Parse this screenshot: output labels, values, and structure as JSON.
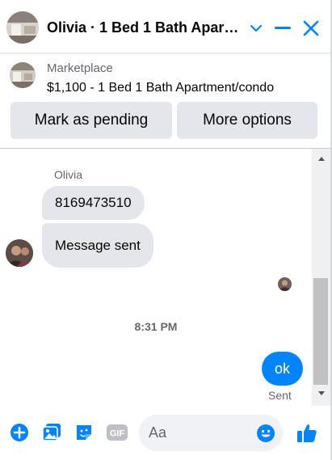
{
  "header": {
    "title": "Olivia · 1 Bed 1 Bath Apartment/condo",
    "icons": [
      "chevron-down-icon",
      "minimize-icon",
      "close-icon"
    ]
  },
  "marketplace": {
    "label": "Marketplace",
    "listing": "$1,100 - 1 Bed 1 Bath Apartment/condo",
    "buttons": {
      "pending": "Mark as pending",
      "more": "More options"
    }
  },
  "messages": {
    "sender": "Olivia",
    "incoming": [
      "8169473510",
      "Message sent"
    ],
    "timestamp": "8:31 PM",
    "outgoing": "ok",
    "status": "Sent"
  },
  "composer": {
    "placeholder": "Aa",
    "icons": [
      "plus-icon",
      "gallery-icon",
      "sticker-icon",
      "gif-icon",
      "emoji-icon",
      "like-icon"
    ],
    "gif_label": "GIF"
  },
  "colors": {
    "accent": "#0084ff",
    "bubble_in": "#e4e6eb",
    "secondary_text": "#65676b"
  }
}
